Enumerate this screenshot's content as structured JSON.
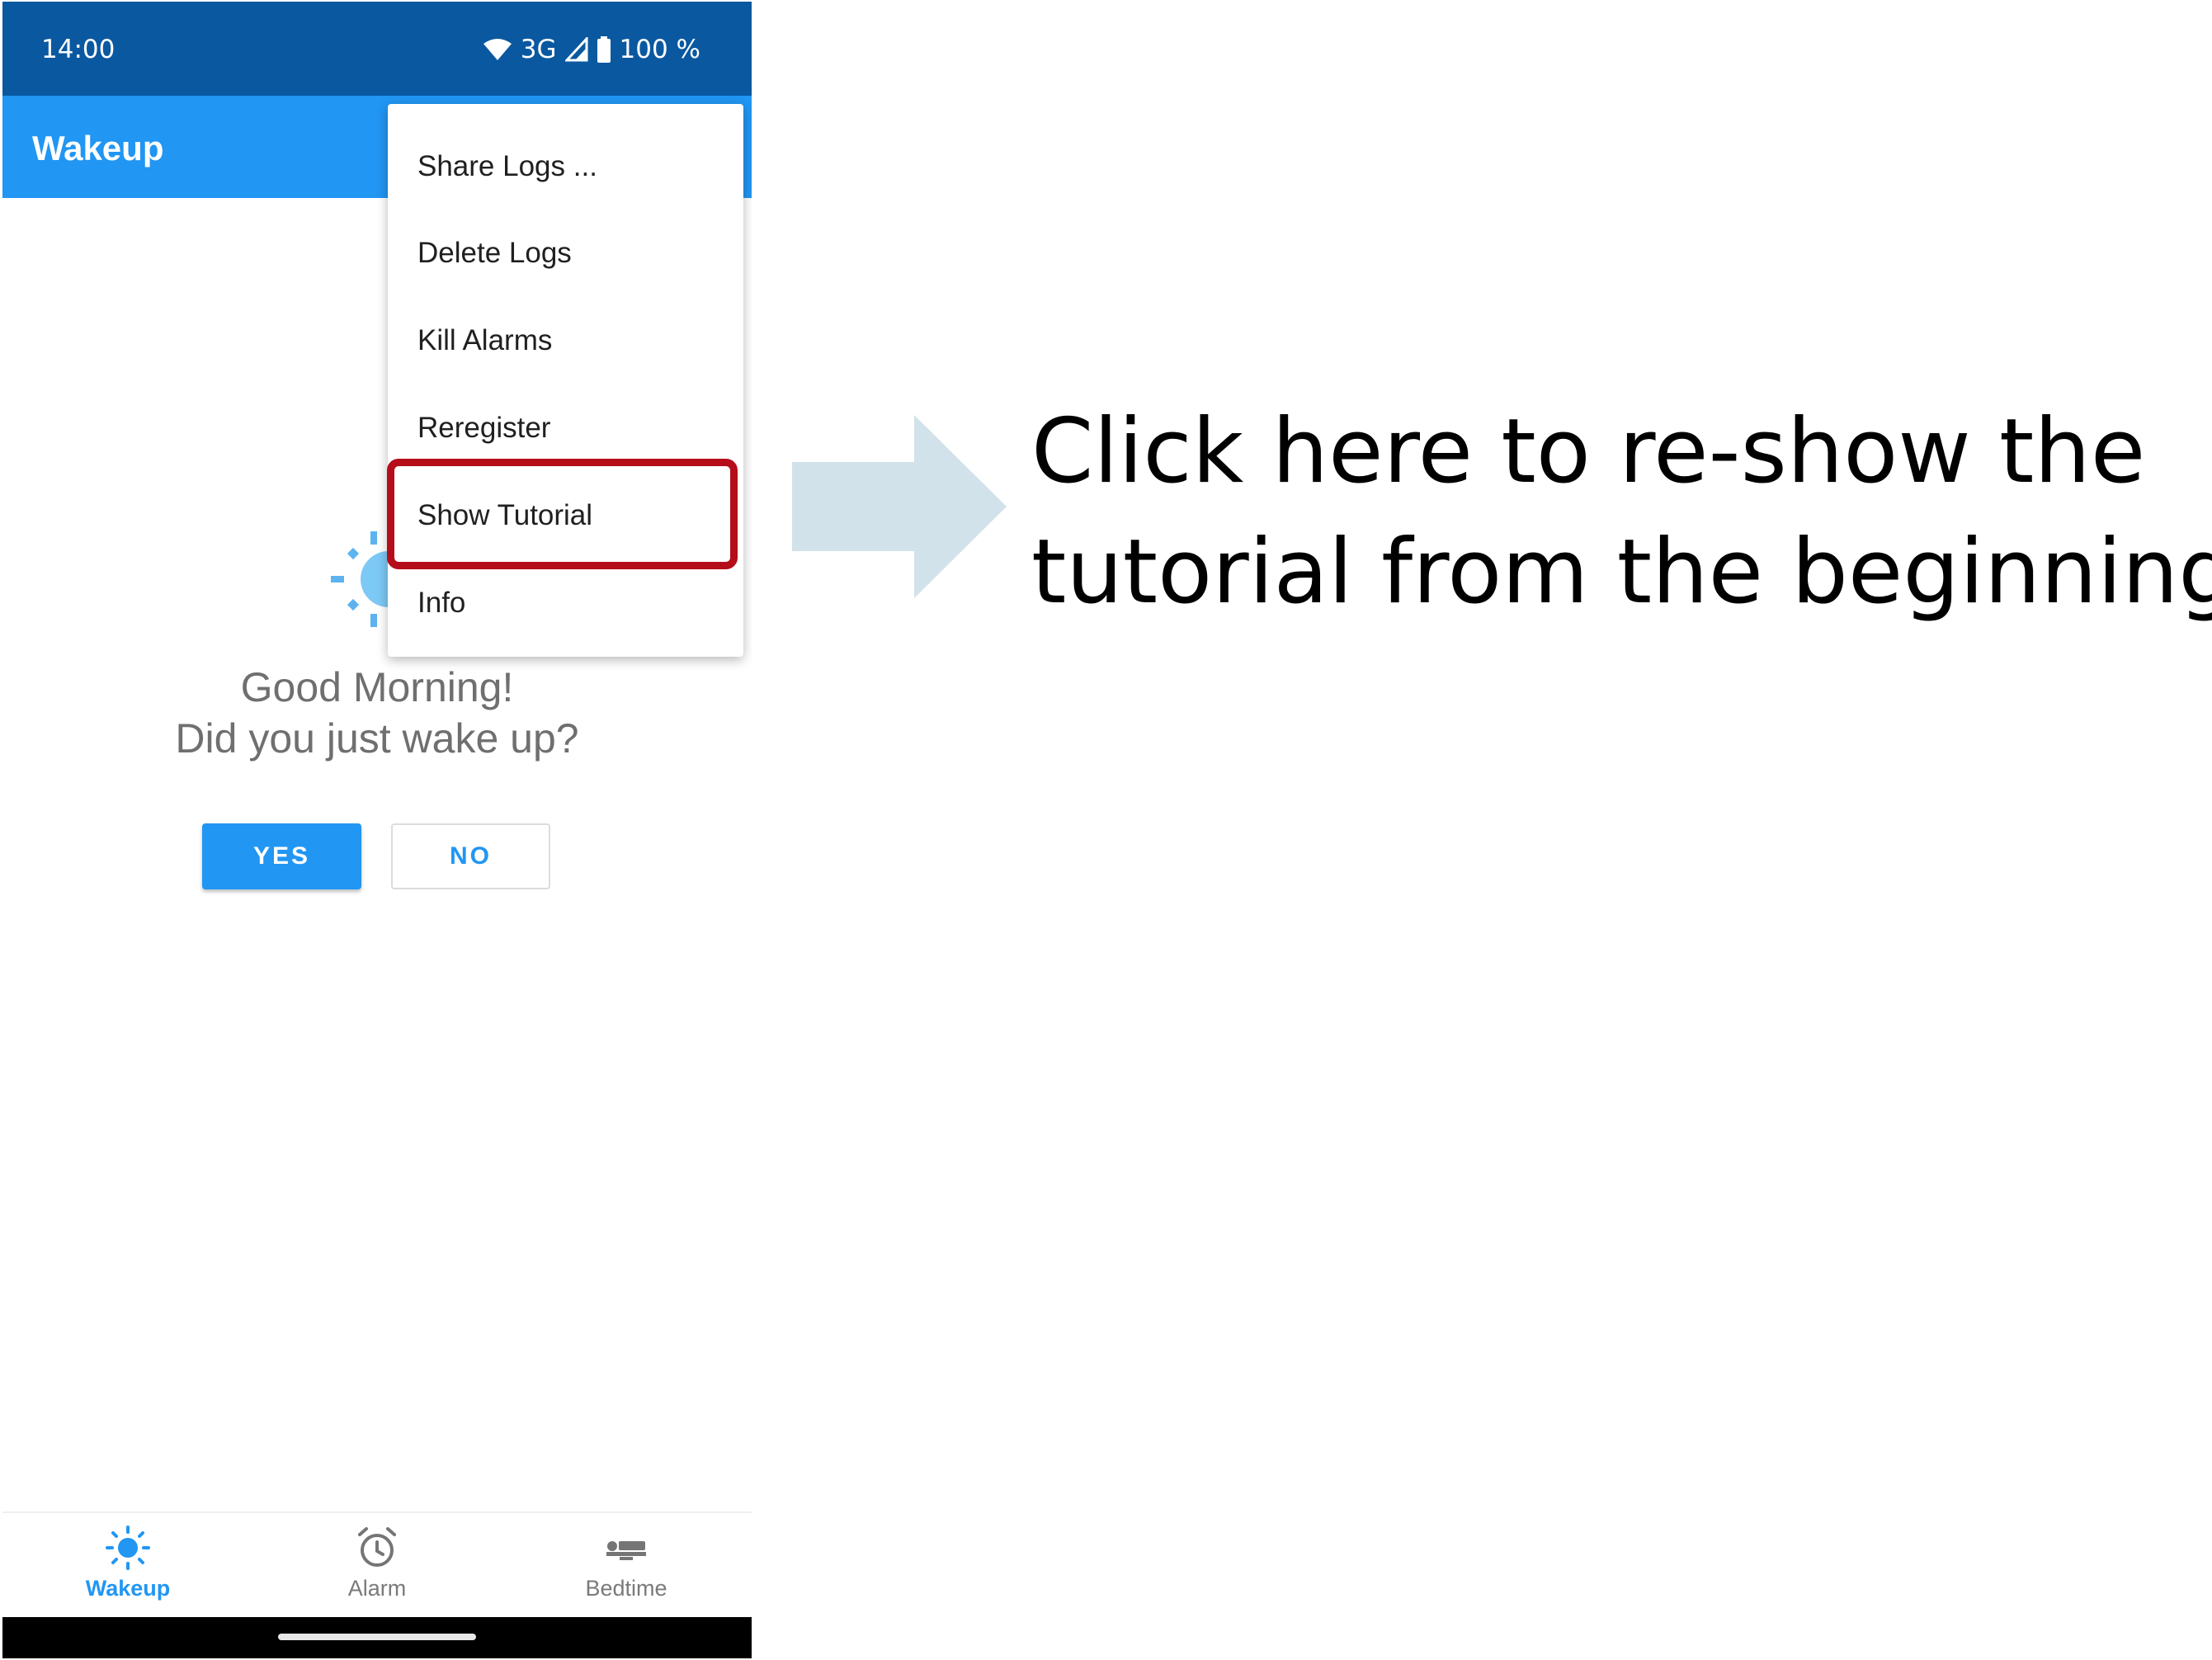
{
  "status_bar": {
    "time": "14:00",
    "network": "3G",
    "battery": "100 %",
    "icons": [
      "wifi-icon",
      "signal-icon",
      "battery-icon"
    ]
  },
  "app_bar": {
    "title": "Wakeup"
  },
  "menu": {
    "items": [
      {
        "label": "Share Logs ..."
      },
      {
        "label": "Delete Logs"
      },
      {
        "label": "Kill Alarms"
      },
      {
        "label": "Reregister"
      },
      {
        "label": "Show Tutorial",
        "highlighted": true
      },
      {
        "label": "Info"
      }
    ],
    "highlight_color": "#b50d1a"
  },
  "main": {
    "greeting_line1": "Good Morning!",
    "greeting_line2": "Did you just wake up?",
    "yes_label": "YES",
    "no_label": "NO"
  },
  "bottom_nav": {
    "items": [
      {
        "label": "Wakeup",
        "icon": "sun-icon",
        "active": true
      },
      {
        "label": "Alarm",
        "icon": "alarm-clock-icon",
        "active": false
      },
      {
        "label": "Bedtime",
        "icon": "bed-icon",
        "active": false
      }
    ]
  },
  "annotation": {
    "line1": "Click here to re-show the",
    "line2": "tutorial from the beginning",
    "arrow_color": "#d2e2ea"
  },
  "colors": {
    "status_bar": "#0a58a0",
    "app_bar": "#2196f3",
    "accent": "#2196f3"
  }
}
